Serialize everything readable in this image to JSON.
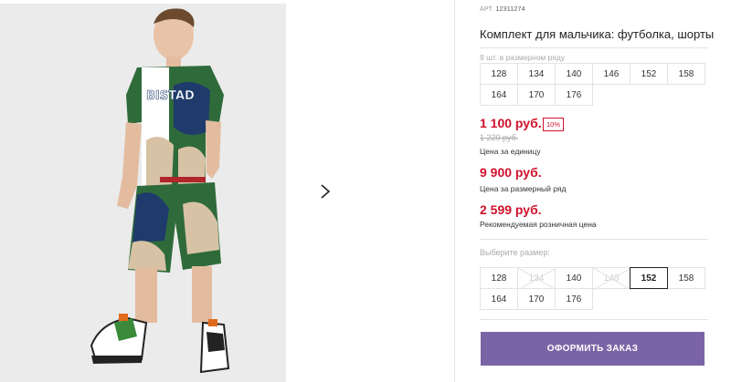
{
  "product": {
    "article_label": "АРТ.",
    "article_value": "12311274",
    "title": "Комплект для мальчика: футболка, шорты"
  },
  "size_row": {
    "note": "9 шт. в размерном ряду",
    "sizes": [
      "128",
      "134",
      "140",
      "146",
      "152",
      "158",
      "164",
      "170",
      "176"
    ]
  },
  "pricing": {
    "unit_price": "1 100 руб.",
    "discount": "10%",
    "old_price": "1 220 руб.",
    "unit_label": "Цена за единицу",
    "row_price": "9 900 руб.",
    "row_label": "Цена за размерный ряд",
    "retail_price": "2 599 руб.",
    "retail_label": "Рекомендуемая розничная цена"
  },
  "size_selector": {
    "label": "Выберите размер:",
    "selected": "152",
    "options": [
      {
        "size": "128",
        "available": true
      },
      {
        "size": "134",
        "available": false
      },
      {
        "size": "140",
        "available": true
      },
      {
        "size": "146",
        "available": false
      },
      {
        "size": "152",
        "available": true
      },
      {
        "size": "158",
        "available": true
      },
      {
        "size": "164",
        "available": true
      },
      {
        "size": "170",
        "available": true
      },
      {
        "size": "176",
        "available": true
      }
    ]
  },
  "actions": {
    "order_label": "ОФОРМИТЬ ЗАКАЗ"
  },
  "icons": {
    "next": "chevron-right-icon",
    "photo": "product-photo"
  },
  "colors": {
    "accent": "#7b64a6",
    "price": "#d0112b"
  }
}
